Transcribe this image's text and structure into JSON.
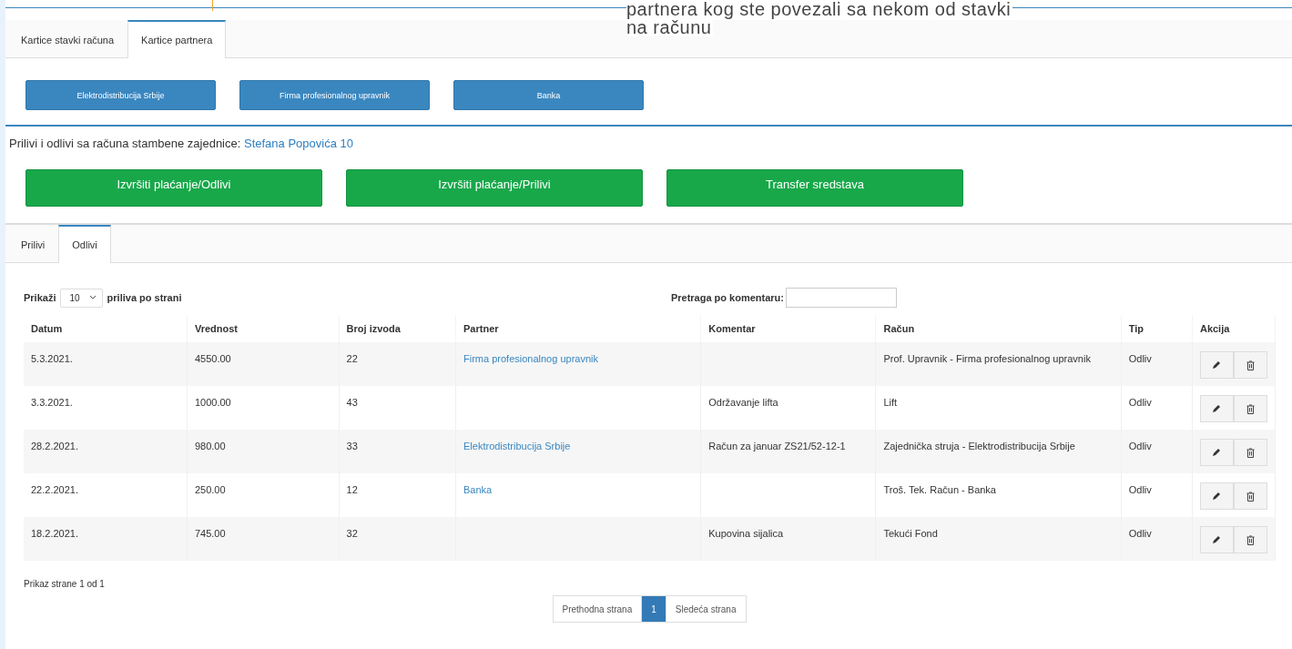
{
  "tooltip": {
    "lines": [
      "partnera kog ste povezali sa nekom od stavki",
      "na računu"
    ]
  },
  "card_tabs": [
    {
      "label": "Kartice stavki računa",
      "selected": false
    },
    {
      "label": "Kartice partnera",
      "selected": true
    }
  ],
  "partner_buttons": [
    "Elektrodistribucija Srbije",
    "Firma profesionalnog upravnik",
    "Banka"
  ],
  "heading": {
    "text": "Prilivi i odlivi sa računa stambene zajednice:",
    "link": "Stefana Popovića 10"
  },
  "action_buttons": [
    "Izvršiti plaćanje/Odlivi",
    "Izvršiti plaćanje/Prilivi",
    "Transfer sredstava"
  ],
  "flow_tabs": [
    {
      "label": "Prilivi",
      "selected": false
    },
    {
      "label": "Odlivi",
      "selected": true
    }
  ],
  "table": {
    "length_before": "Prikaži",
    "length_value": "10",
    "length_after": "priliva po strani",
    "search_label": "Pretraga po komentaru:",
    "columns": [
      "Datum",
      "Vrednost",
      "Broj izvoda",
      "Partner",
      "Komentar",
      "Račun",
      "Tip",
      "Akcija"
    ],
    "rows": [
      {
        "date": "5.3.2021.",
        "amount": "4550.00",
        "statement": "22",
        "partner": "Firma profesionalnog upravnik",
        "account": "Prof. Upravnik - Firma profesionalnog upravnik",
        "type": "Odliv"
      },
      {
        "date": "3.3.2021.",
        "amount": "1000.00",
        "statement": "43",
        "comment": "Održavanje lifta",
        "account": "Lift",
        "type": "Odliv"
      },
      {
        "date": "28.2.2021.",
        "amount": "980.00",
        "statement": "33",
        "partner": "Elektrodistribucija Srbije",
        "comment": "Račun za januar ZS21/52-12-1",
        "account": "Zajednička struja - Elektrodistribucija Srbije",
        "type": "Odliv"
      },
      {
        "date": "22.2.2021.",
        "amount": "250.00",
        "statement": "12",
        "partner": "Banka",
        "account": "Troš. Tek. Račun - Banka",
        "type": "Odliv"
      },
      {
        "date": "18.2.2021.",
        "amount": "745.00",
        "statement": "32",
        "comment": "Kupovina sijalica",
        "account": "Tekući Fond",
        "type": "Odliv"
      }
    ]
  },
  "page_info": "Prikaz strane 1 od 1",
  "pagination": [
    {
      "label": "Prethodna strana",
      "selected": false
    },
    {
      "label": "1",
      "selected": true
    },
    {
      "label": "Sledeća strana",
      "selected": false
    }
  ]
}
